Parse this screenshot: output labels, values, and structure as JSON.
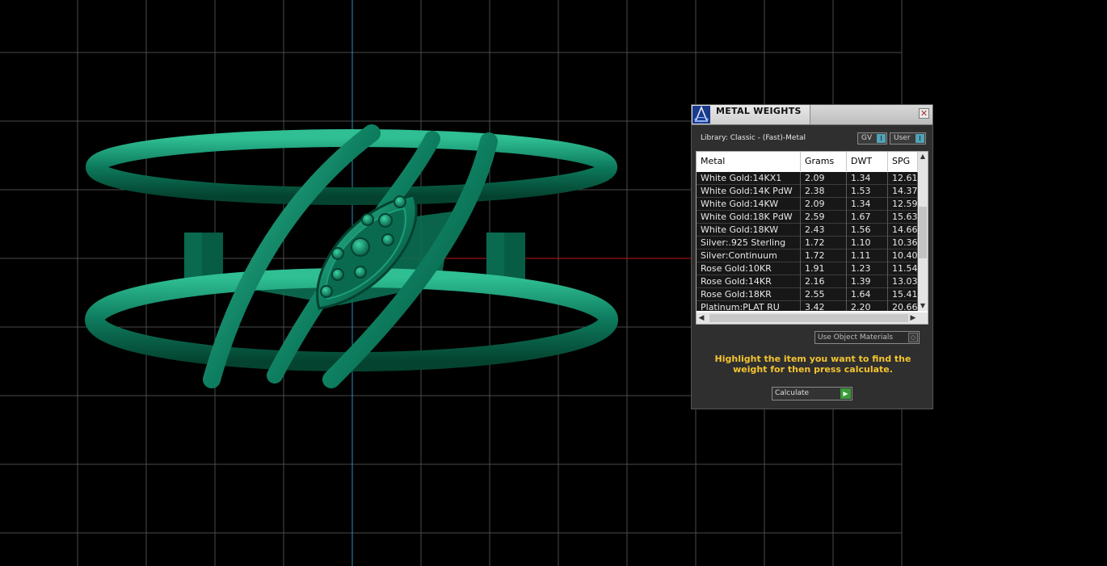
{
  "panel": {
    "title": "METAL WEIGHTS",
    "close_label": "✕",
    "library_label": "Library: Classic - (Fast)-Metal",
    "toggle_gv": "GV",
    "toggle_user": "User",
    "toggle_knob": "I",
    "columns": [
      "Metal",
      "Grams",
      "DWT",
      "SPG"
    ],
    "rows": [
      [
        "White Gold:14KX1",
        "2.09",
        "1.34",
        "12.61"
      ],
      [
        "White Gold:14K PdW",
        "2.38",
        "1.53",
        "14.37"
      ],
      [
        "White Gold:14KW",
        "2.09",
        "1.34",
        "12.59"
      ],
      [
        "White Gold:18K PdW",
        "2.59",
        "1.67",
        "15.63"
      ],
      [
        "White Gold:18KW",
        "2.43",
        "1.56",
        "14.66"
      ],
      [
        "Silver:.925 Sterling",
        "1.72",
        "1.10",
        "10.36"
      ],
      [
        "Silver:Continuum",
        "1.72",
        "1.11",
        "10.40"
      ],
      [
        "Rose Gold:10KR",
        "1.91",
        "1.23",
        "11.54"
      ],
      [
        "Rose Gold:14KR",
        "2.16",
        "1.39",
        "13.03"
      ],
      [
        "Rose Gold:18KR",
        "2.55",
        "1.64",
        "15.41"
      ],
      [
        "Platinum:PLAT RU",
        "3.42",
        "2.20",
        "20.66"
      ]
    ],
    "use_object_materials": "Use Object Materials",
    "hint": "Highlight the item you want to find the weight for then press calculate.",
    "calculate_label": "Calculate"
  },
  "colors": {
    "ring": "#0b6b52",
    "ring_highlight": "#2fbf93",
    "grid": "#4a4a4a",
    "axis_y": "#2a8fb5",
    "axis_x": "#c01818",
    "hint": "#f4c430"
  }
}
